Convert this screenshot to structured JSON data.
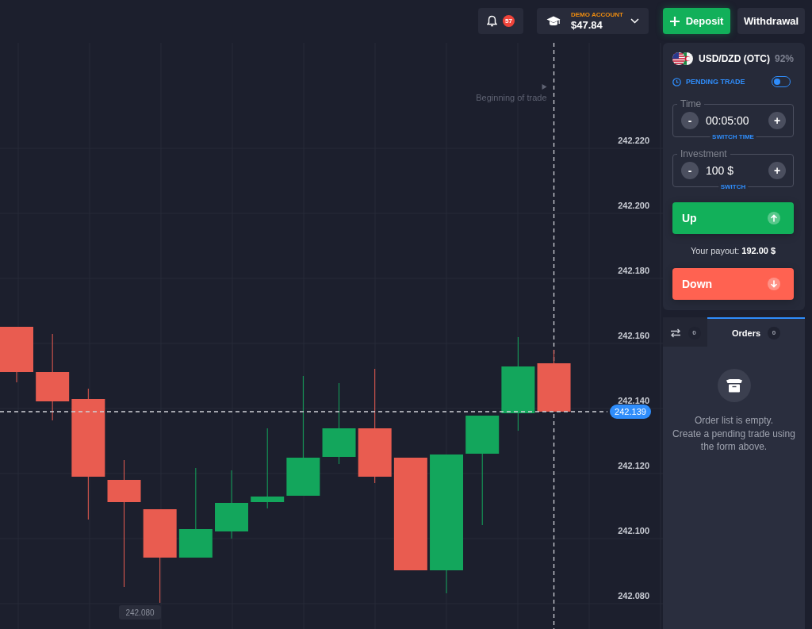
{
  "header": {
    "notifications": {
      "count": "57"
    },
    "account": {
      "type_label": "DEMO ACCOUNT",
      "balance": "$47.84"
    },
    "deposit_button": "Deposit",
    "withdraw_button": "Withdrawal"
  },
  "chart": {
    "trade_start_label": "Beginning of trade",
    "price_labels": [
      "242.220",
      "242.200",
      "242.180",
      "242.160",
      "242.140",
      "242.120",
      "242.100",
      "242.080"
    ],
    "current_price": "242.139",
    "price_tag": "242.080"
  },
  "trade_panel": {
    "asset": "USD/DZD (OTC)",
    "payout_percent": "92%",
    "pending_trade": {
      "label": "PENDING TRADE",
      "on": false
    },
    "fields": [
      {
        "legend": "Time",
        "value": "00:05:00",
        "decrement": "-",
        "increment": "+",
        "switch_label": "SWITCH TIME"
      },
      {
        "legend": "Investment",
        "value": "100 $",
        "decrement": "-",
        "increment": "+",
        "switch_label": "SWITCH"
      }
    ],
    "up_button": "Up",
    "payout": "Your payout: **192.00 $**",
    "down_button": "Down"
  },
  "orders_panel": {
    "tabs": [
      {
        "kind": "icon",
        "count": "0",
        "selected": false
      },
      {
        "kind": "label",
        "label": "Orders",
        "count": "0",
        "selected": true
      }
    ],
    "empty_message": [
      "Order list is empty.",
      "Create a pending trade using the form above."
    ]
  }
}
